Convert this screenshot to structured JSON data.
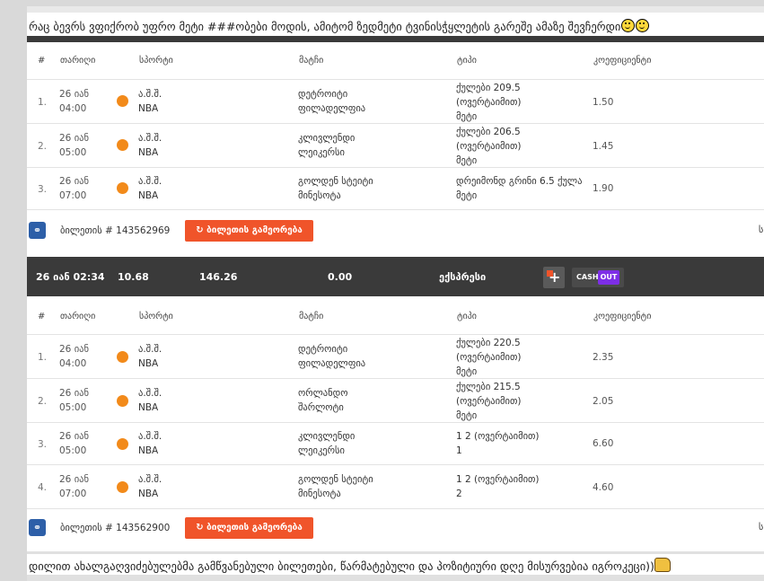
{
  "post_top": "რაც ბევრს ვფიქრობ უფრო მეტი ###ობები მოდის, ამიტომ ზედმეტი ტვინისჭყლეტის გარეშე ამაზე შევჩერდი",
  "post_bottom": "დილით ახალგაღვიძებულებმა გამწვანებული ბილეთები, წარმატებული და პოზიტიური დღე მისურვებია იგროკეცი))",
  "headers": {
    "num": "#",
    "date": "თარიღი",
    "sport": "სპორტი",
    "match": "მატჩი",
    "type": "ტიპი",
    "odds": "კოეფიციენტი"
  },
  "ticket1": {
    "rows": [
      {
        "n": "1.",
        "date": "26 იან",
        "time": "04:00",
        "country": "ა.შ.შ.",
        "league": "NBA",
        "team1": "დეტროიტი",
        "team2": "ფილადელფია",
        "type1": "ქულები 209.5",
        "type2": "(ოვერტაიმით)",
        "type3": "მეტი",
        "odds": "1.50"
      },
      {
        "n": "2.",
        "date": "26 იან",
        "time": "05:00",
        "country": "ა.შ.შ.",
        "league": "NBA",
        "team1": "კლივლენდი",
        "team2": "ლეიკერსი",
        "type1": "ქულები 206.5",
        "type2": "(ოვერტაიმით)",
        "type3": "მეტი",
        "odds": "1.45"
      },
      {
        "n": "3.",
        "date": "26 იან",
        "time": "07:00",
        "country": "ა.შ.შ.",
        "league": "NBA",
        "team1": "გოლდენ სტეიტი",
        "team2": "მინესოტა",
        "type1": "დრეიმონდ გრინი 6.5 ქულა",
        "type2": "მეტი",
        "type3": "",
        "odds": "1.90"
      }
    ],
    "ticket_label": "ბილეთის # 143562969",
    "repeat_label": "ბილეთის გამეორება",
    "trunc": "ს"
  },
  "summary": {
    "datetime": "26 იან 02:34",
    "stake": "10.68",
    "total_odds": "146.26",
    "win": "0.00",
    "kind": "ექსპრესი",
    "cash_label": "CASH",
    "out_label": "OUT"
  },
  "ticket2": {
    "rows": [
      {
        "n": "1.",
        "date": "26 იან",
        "time": "04:00",
        "country": "ა.შ.შ.",
        "league": "NBA",
        "team1": "დეტროიტი",
        "team2": "ფილადელფია",
        "type1": "ქულები 220.5",
        "type2": "(ოვერტაიმით)",
        "type3": "მეტი",
        "odds": "2.35"
      },
      {
        "n": "2.",
        "date": "26 იან",
        "time": "05:00",
        "country": "ა.შ.შ.",
        "league": "NBA",
        "team1": "ორლანდო",
        "team2": "შარლოტი",
        "type1": "ქულები 215.5",
        "type2": "(ოვერტაიმით)",
        "type3": "მეტი",
        "odds": "2.05"
      },
      {
        "n": "3.",
        "date": "26 იან",
        "time": "05:00",
        "country": "ა.შ.შ.",
        "league": "NBA",
        "team1": "კლივლენდი",
        "team2": "ლეიკერსი",
        "type1": "1 2 (ოვერტაიმით)",
        "type2": "1",
        "type3": "",
        "odds": "6.60"
      },
      {
        "n": "4.",
        "date": "26 იან",
        "time": "07:00",
        "country": "ა.შ.შ.",
        "league": "NBA",
        "team1": "გოლდენ სტეიტი",
        "team2": "მინესოტა",
        "type1": "1 2 (ოვერტაიმით)",
        "type2": "2",
        "type3": "",
        "odds": "4.60"
      }
    ],
    "ticket_label": "ბილეთის # 143562900",
    "repeat_label": "ბილეთის გამეორება",
    "trunc": "ს"
  },
  "colors": {
    "accent": "#f0542a",
    "dark_bar": "#3a3a3a",
    "share": "#2d5fa8",
    "sport_dot": "#f28a1a",
    "cashout": "#7d2ee6"
  },
  "icons": {
    "share": "share-icon",
    "repeat": "refresh-icon",
    "add": "plus-icon",
    "sport": "basketball-icon",
    "emoji1": "smiley-icon",
    "emoji2": "thumbs-up-icon"
  }
}
